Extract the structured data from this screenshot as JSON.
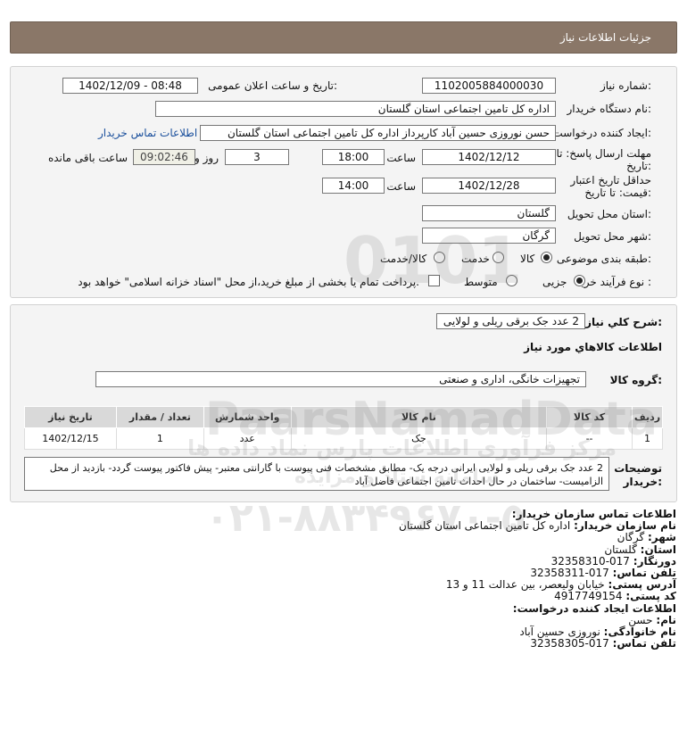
{
  "header": {
    "title": "جزئیات اطلاعات نیاز"
  },
  "form": {
    "need_no_label": "شماره نیاز:",
    "need_no": "1102005884000030",
    "pub_label": "تاریخ و ساعت اعلان عمومی:",
    "pub_value": "1402/12/09 - 08:48",
    "buyer_label": "نام دستگاه خریدار:",
    "buyer": "اداره کل تامین اجتماعی استان گلستان",
    "creator_label": "ایجاد کننده درخواست:",
    "creator": "حسن نوروزی حسین آباد کارپرداز اداره کل تامین اجتماعی استان گلستان",
    "contact_link": "اطلاعات تماس خریدار",
    "send_label_1": "مهلت ارسال پاسخ: تا",
    "send_label_2": "تاریخ:",
    "send_date": "1402/12/12",
    "time_label": "ساعت",
    "send_time": "18:00",
    "days": "3",
    "days_label": "روز و",
    "remain_time": "09:02:46",
    "remain_label": "ساعت باقی مانده",
    "valid_label_1": "حداقل تاریخ اعتبار",
    "valid_label_2": "قیمت: تا تاریخ:",
    "valid_date": "1402/12/28",
    "valid_time": "14:00",
    "province_label": "استان محل تحویل:",
    "province": "گلستان",
    "city_label": "شهر محل تحویل:",
    "city": "گرگان",
    "category_label": "طبقه بندی موضوعی:",
    "cat_goods": "کالا",
    "cat_service": "خدمت",
    "cat_both": "کالا/خدمت",
    "process_label": "نوع فرآیند خرید :",
    "proc_small": "جزیی",
    "proc_medium": "متوسط",
    "treasury_note": "پرداخت تمام یا بخشی از مبلغ خرید،از محل \"اسناد خزانه اسلامی\" خواهد بود."
  },
  "need": {
    "summary_label": "شرح کلي نياز:",
    "summary": "2 عدد جک برقی ریلی و لولایی",
    "goods_info_title": "اطلاعات کالاهاي مورد نياز",
    "group_label": "گروه کالا:",
    "group": "تجهیزات خانگی، اداری و صنعتی",
    "table_headers": [
      "ردیف",
      "کد کالا",
      "نام کالا",
      "واحد شمارش",
      "تعداد / مقدار",
      "تاریخ نیاز"
    ],
    "rows": [
      [
        "1",
        "--",
        "جک",
        "عدد",
        "1",
        "1402/12/15"
      ]
    ],
    "buyer_desc_label_1": "توضیحات",
    "buyer_desc_label_2": "خریدار:",
    "buyer_desc": "2 عدد جک برقی ریلی و لولایی ایرانی درجه یک- مطابق مشخصات فنی پیوست با گارانتی معتبر- پیش فاکتور پیوست گردد- بازدید از محل الزامیست- ساختمان در حال احداث تامین اجتماعی فاضل آباد"
  },
  "contact": {
    "org_title": "اطلاعات تماس سازمان خریدار:",
    "buyer_name_label": "نام سازمان خریدار:",
    "buyer_name": "اداره کل تامین اجتماعی استان گلستان",
    "city_label": "شهر:",
    "city": "گرگان",
    "province_label": "استان:",
    "province": "گلستان",
    "fax_label": "دورنگار:",
    "fax": "017-32358310",
    "phone_label": "تلفن تماس:",
    "phone": "017-32358311",
    "address_label": "آدرس پستی:",
    "address": "خیابان ولیعصر، بین عدالت 11 و 13",
    "postal_label": "کد پستی:",
    "postal": "4917749154",
    "creator_title": "اطلاعات ایجاد کننده درخواست:",
    "first_name_label": "نام:",
    "first_name": "حسن",
    "last_name_label": "نام خانوادگی:",
    "last_name": "نوروزی حسین آباد",
    "creator_phone_label": "تلفن تماس:",
    "creator_phone": "017-32358305"
  },
  "watermark": {
    "brand": "PaarsNamadData",
    "persian": "مرکز فرآوری اطلاعات پارس نماد داده ها",
    "persian2": "سامانه ستاد و مزایده",
    "phone": "۰۲۱-۸۸۳۴۹۶۷۰-۵",
    "digits": "0101"
  },
  "colors": {
    "header_bg": "#8a7768",
    "panel_bg": "#f4f4f4",
    "link": "#1a4f9c"
  }
}
